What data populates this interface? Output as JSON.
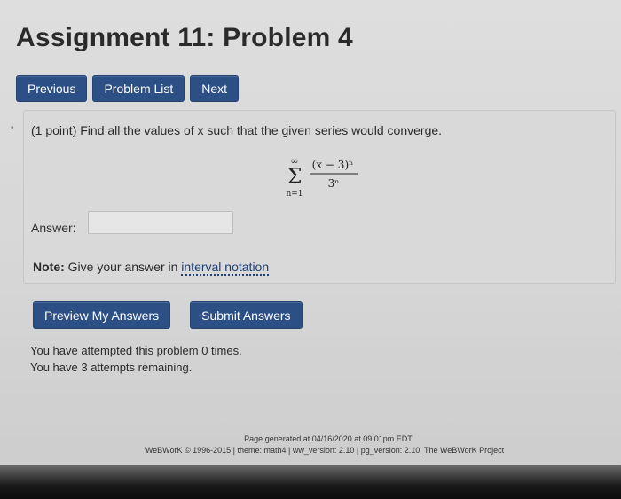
{
  "header": {
    "title": "Assignment 11: Problem 4"
  },
  "nav": {
    "previous_label": "Previous",
    "problem_list_label": "Problem List",
    "next_label": "Next"
  },
  "problem": {
    "prompt": "(1 point) Find all the values of x such that the given series would converge.",
    "formula": {
      "upper_limit": "∞",
      "sigma": "Σ",
      "lower_limit": "n=1",
      "numerator": "(x − 3)ⁿ",
      "denominator": "3ⁿ"
    },
    "answer_label": "Answer:",
    "answer_value": "",
    "note_bold": "Note:",
    "note_text": " Give your answer in ",
    "note_link": "interval notation"
  },
  "actions": {
    "preview_label": "Preview My Answers",
    "submit_label": "Submit Answers"
  },
  "status": {
    "attempted": "You have attempted this problem 0 times.",
    "remaining": "You have 3 attempts remaining."
  },
  "footer": {
    "generated": "Page generated at 04/16/2020 at 09:01pm EDT",
    "copyright": "WeBWorK © 1996-2015 | theme: math4 | ww_version: 2.10 | pg_version: 2.10| The WeBWorK Project"
  },
  "colors": {
    "button_bg": "#2c4f86",
    "page_bg": "#d8d8d8"
  }
}
